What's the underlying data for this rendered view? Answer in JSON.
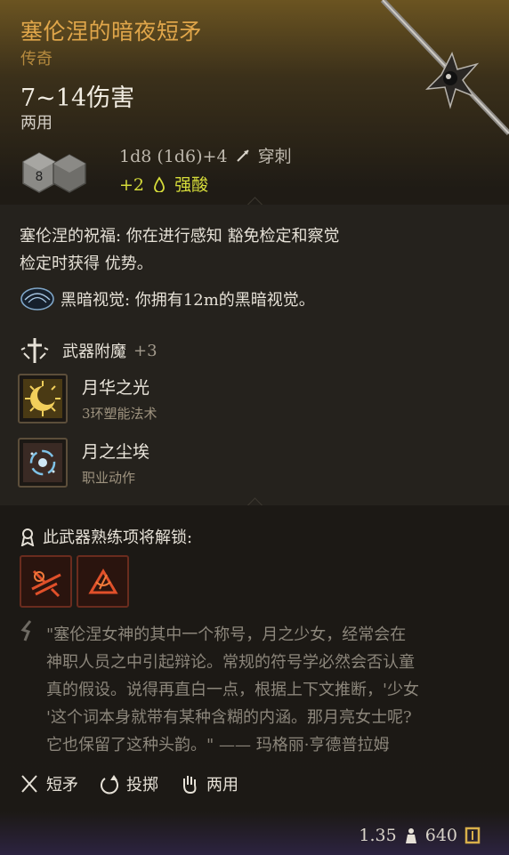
{
  "item": {
    "name": "塞伦涅的暗夜短矛",
    "rarity": "传奇",
    "damage": "7~14伤害",
    "handedness": "两用",
    "damage_roll": "1d8 (1d6)+4",
    "damage_type": "穿刺",
    "bonus_damage": "+2",
    "bonus_type": "强酸",
    "die_value": "8"
  },
  "properties": {
    "blessing_line1": "塞伦涅的祝福: 你在进行感知 豁免检定和察觉",
    "blessing_line2": "检定时获得 优势。",
    "darkvision": "黑暗视觉: 你拥有12m的黑暗视觉。",
    "enchant_label": "武器附魔",
    "enchant_value": "+3",
    "spells": [
      {
        "name": "月华之光",
        "sub": "3环塑能法术"
      },
      {
        "name": "月之尘埃",
        "sub": "职业动作"
      }
    ]
  },
  "proficiency": {
    "unlock_label": "此武器熟练项将解锁:"
  },
  "lore": {
    "line1": "\"塞伦涅女神的其中一个称号，月之少女，经常会在",
    "line2": "神职人员之中引起辩论。常规的符号学必然会否认童",
    "line3": "真的假设。说得再直白一点，根据上下文推断，'少女",
    "line4": "'这个词本身就带有某种含糊的内涵。那月亮女士呢?",
    "line5": "它也保留了这种头韵。\" —— 玛格丽·亨德普拉姆"
  },
  "weapon_props": {
    "type": "短矛",
    "thrown": "投掷",
    "versatile": "两用"
  },
  "footer": {
    "weight": "1.35",
    "value": "640"
  },
  "colors": {
    "title": "#e0a64a",
    "rarity": "#b68a3e",
    "bonus": "#d6dc3a"
  },
  "icons": [
    "dice-icon",
    "pierce-icon",
    "acid-icon",
    "spear-illustration",
    "darkvision-icon",
    "enchant-icon",
    "moonbeam-icon",
    "moondust-icon",
    "unlock-icon",
    "action-icon",
    "quote-icon",
    "short-spear-icon",
    "thrown-icon",
    "versatile-icon",
    "weight-icon",
    "gold-icon"
  ]
}
